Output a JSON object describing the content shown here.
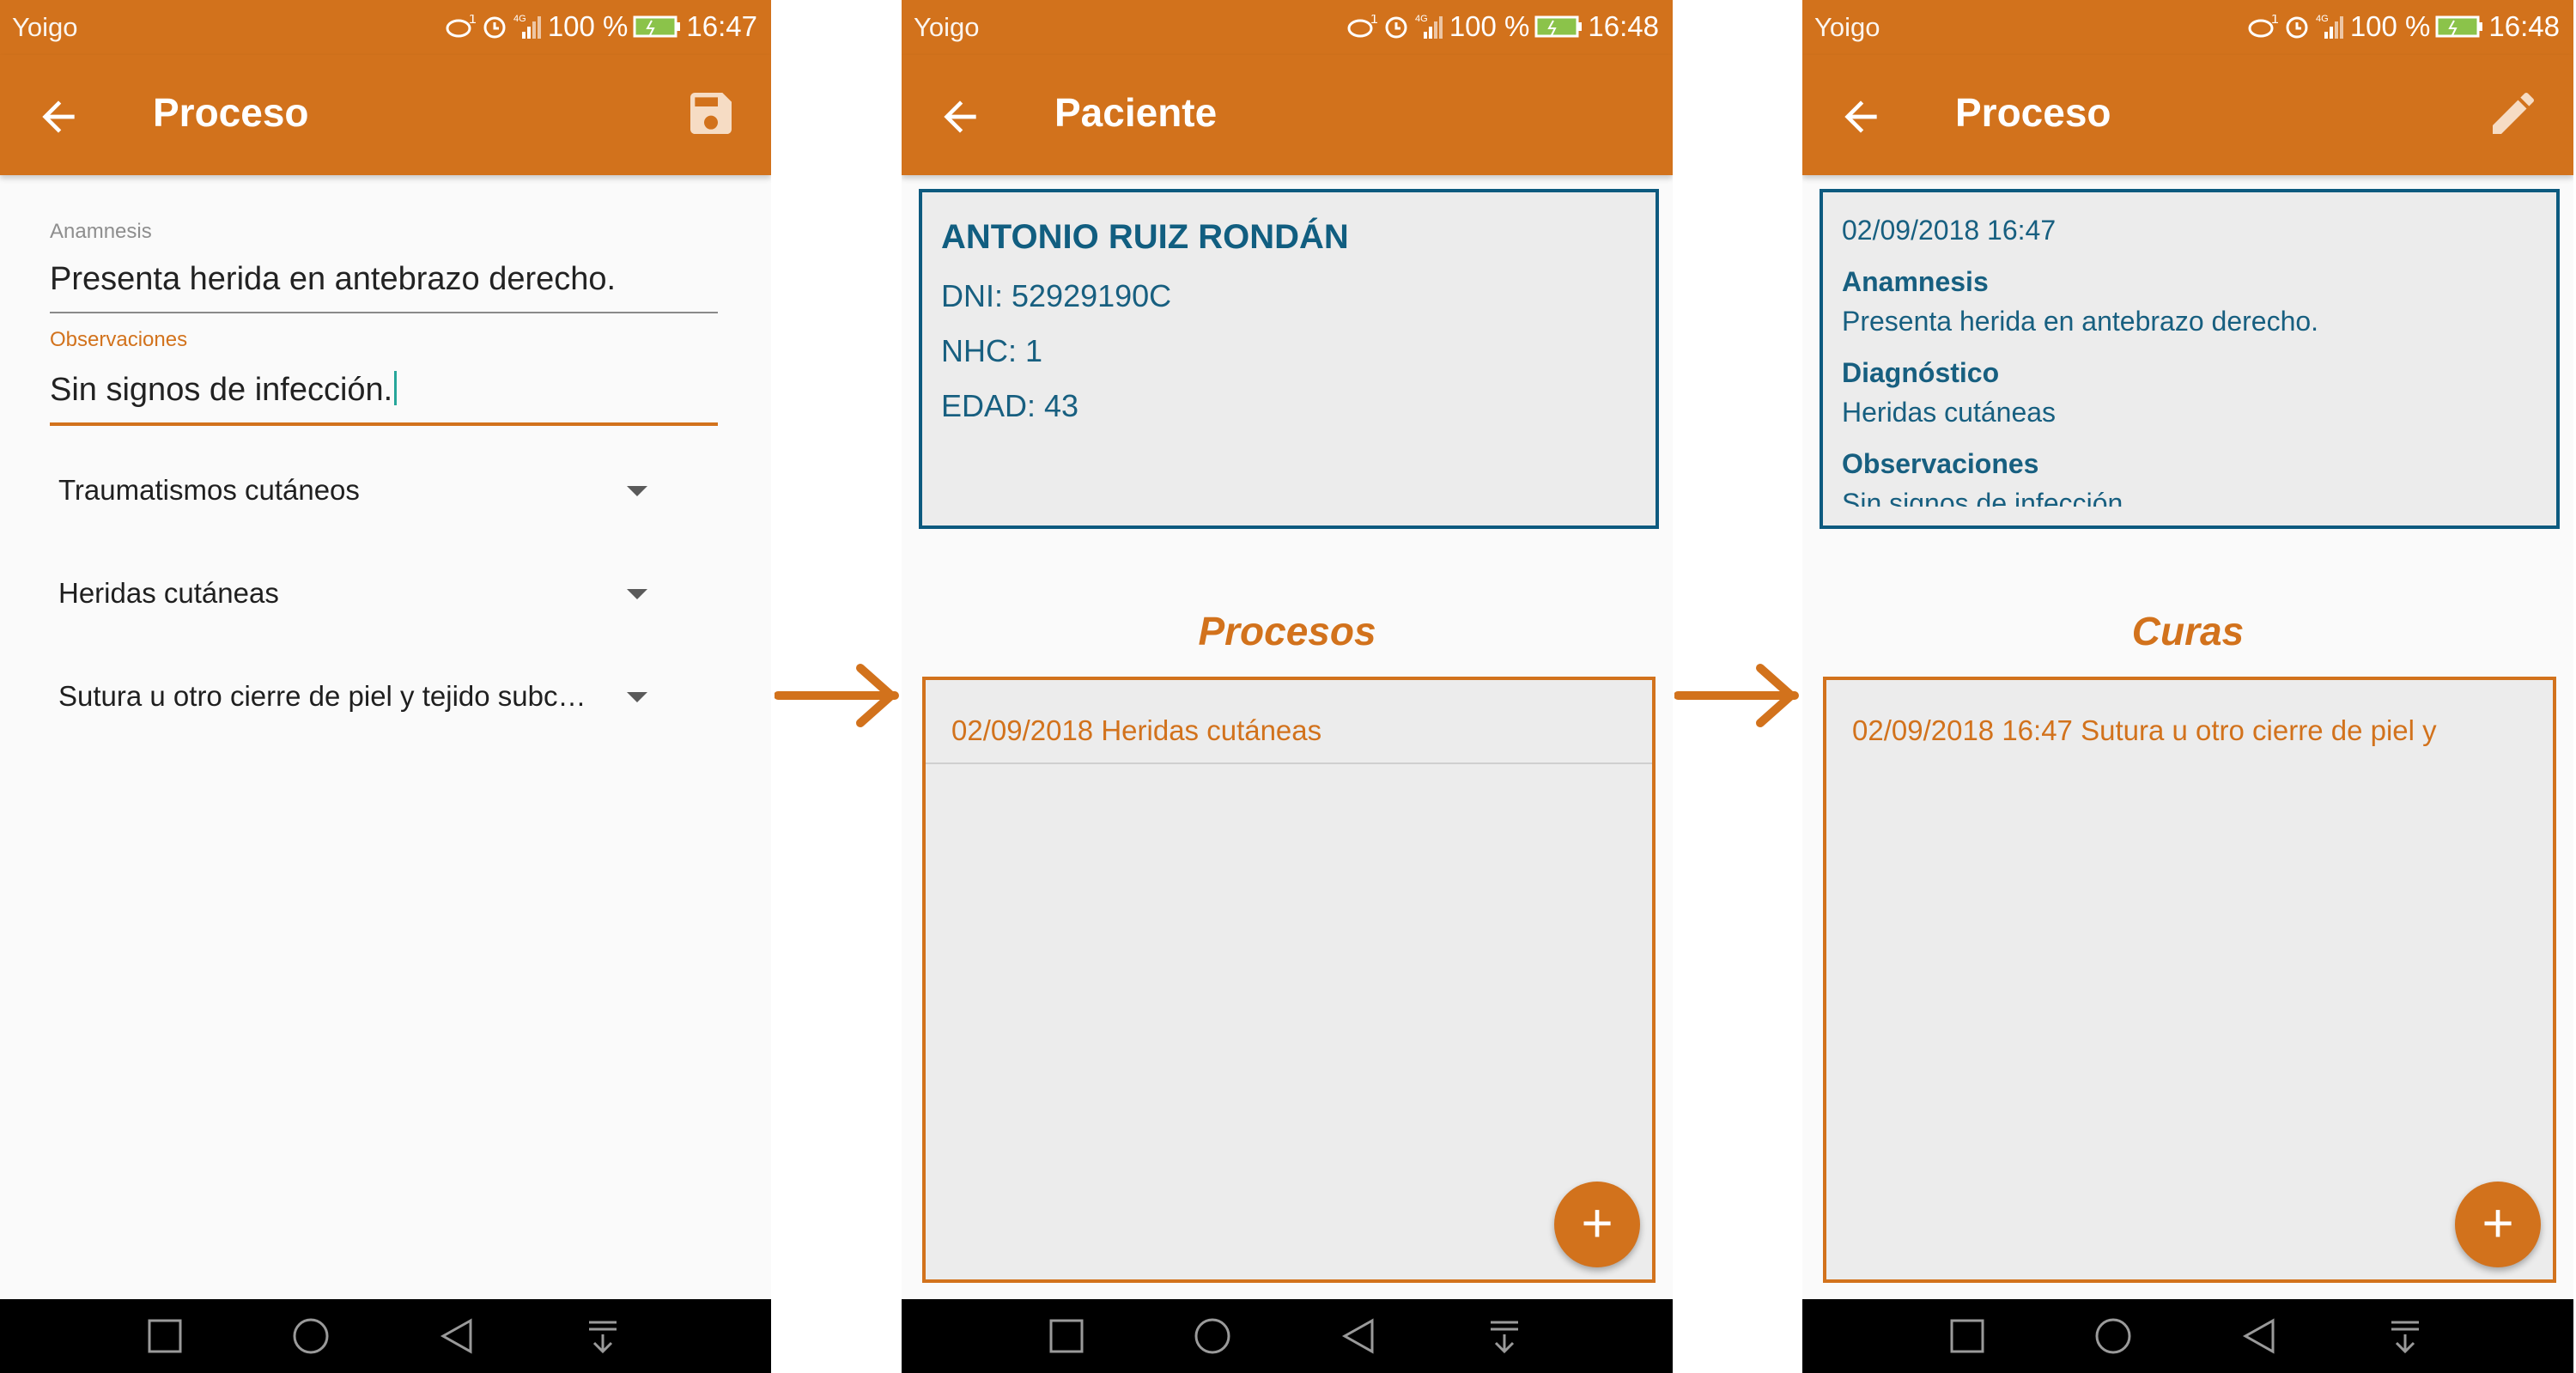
{
  "status": {
    "carrier": "Yoigo",
    "sim": "1",
    "network": "4G",
    "battery": "100 %",
    "times": [
      "16:47",
      "16:48",
      "16:48"
    ]
  },
  "screen1": {
    "title": "Proceso",
    "anamnesis_label": "Anamnesis",
    "anamnesis_value": "Presenta herida en antebrazo derecho.",
    "obs_label": "Observaciones",
    "obs_value": "Sin signos de infección.",
    "spinners": [
      "Traumatismos cutáneos",
      "Heridas cutáneas",
      "Sutura u otro cierre de piel y tejido subc…"
    ]
  },
  "screen2": {
    "title": "Paciente",
    "name": "ANTONIO RUIZ RONDÁN",
    "dni": "DNI: 52929190C",
    "nhc": "NHC: 1",
    "edad": "EDAD: 43",
    "section": "Procesos",
    "items": [
      "02/09/2018 Heridas cutáneas"
    ],
    "fab": "+"
  },
  "screen3": {
    "title": "Proceso",
    "date": "02/09/2018 16:47",
    "anamnesis_label": "Anamnesis",
    "anamnesis_value": "Presenta herida en antebrazo derecho.",
    "diag_label": "Diagnóstico",
    "diag_value": "Heridas cutáneas",
    "obs_label": "Observaciones",
    "obs_value": "Sin signos de infección.",
    "section": "Curas",
    "items": [
      "02/09/2018 16:47 Sutura u otro cierre de piel y"
    ],
    "fab": "+"
  },
  "colors": {
    "primary": "#d2721c",
    "teal": "#0d5a7f",
    "nav": "#000000"
  },
  "icons": [
    "back-arrow-icon",
    "save-icon",
    "edit-pencil-icon",
    "dropdown-icon",
    "add-icon",
    "square-nav-icon",
    "circle-nav-icon",
    "triangle-nav-icon",
    "notification-pull-icon"
  ]
}
